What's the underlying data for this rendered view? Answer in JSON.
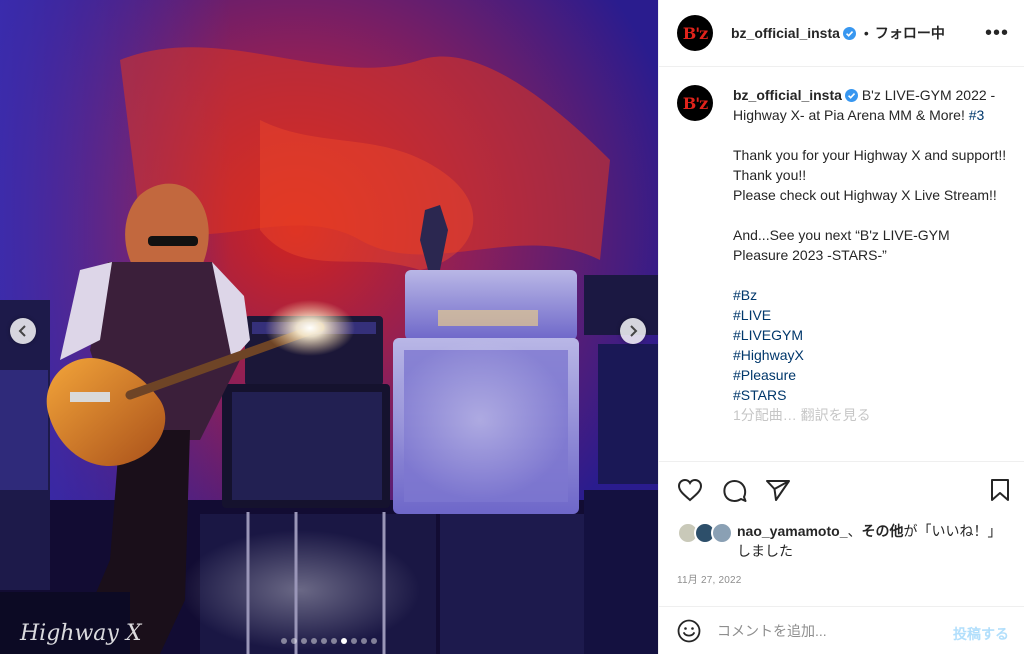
{
  "post": {
    "slide_count": 10,
    "active_slide": 6
  },
  "header": {
    "avatar_text": "B'z",
    "username": "bz_official_insta",
    "separator": "•",
    "follow_label": "フォロー中",
    "more_label": "•••"
  },
  "caption": {
    "username": "bz_official_insta",
    "title": "B'z LIVE-GYM 2022 -Highway X- at Pia Arena MM & More!",
    "title_tag": "#3",
    "line1": "Thank you for your Highway X and support!! Thank you!!",
    "line2": "Please check out Highway X Live Stream!!",
    "line3": "And...See you next “B'z LIVE-GYM Pleasure 2023 -STARS-”",
    "hashtags": [
      "#Bz",
      "#LIVE",
      "#LIVEGYM",
      "#HighwayX",
      "#Pleasure",
      "#STARS"
    ],
    "cut_line": "1分配曲… 翻訳を見る"
  },
  "likes": {
    "user": "nao_yamamoto_",
    "connector": "、",
    "others": "その他",
    "suffix": "が「いいね！」しました"
  },
  "date": "11月 27, 2022",
  "comment": {
    "placeholder": "コメントを追加...",
    "post_label": "投稿する"
  },
  "colors": {
    "link": "#00376b",
    "verified": "#3897f0",
    "post_disabled": "#b2dffc",
    "avatar_logo": "#e0231b"
  },
  "icons": [
    "heart-icon",
    "comment-icon",
    "share-icon",
    "bookmark-icon",
    "emoji-icon",
    "verified-icon",
    "chevron-left-icon",
    "chevron-right-icon"
  ]
}
